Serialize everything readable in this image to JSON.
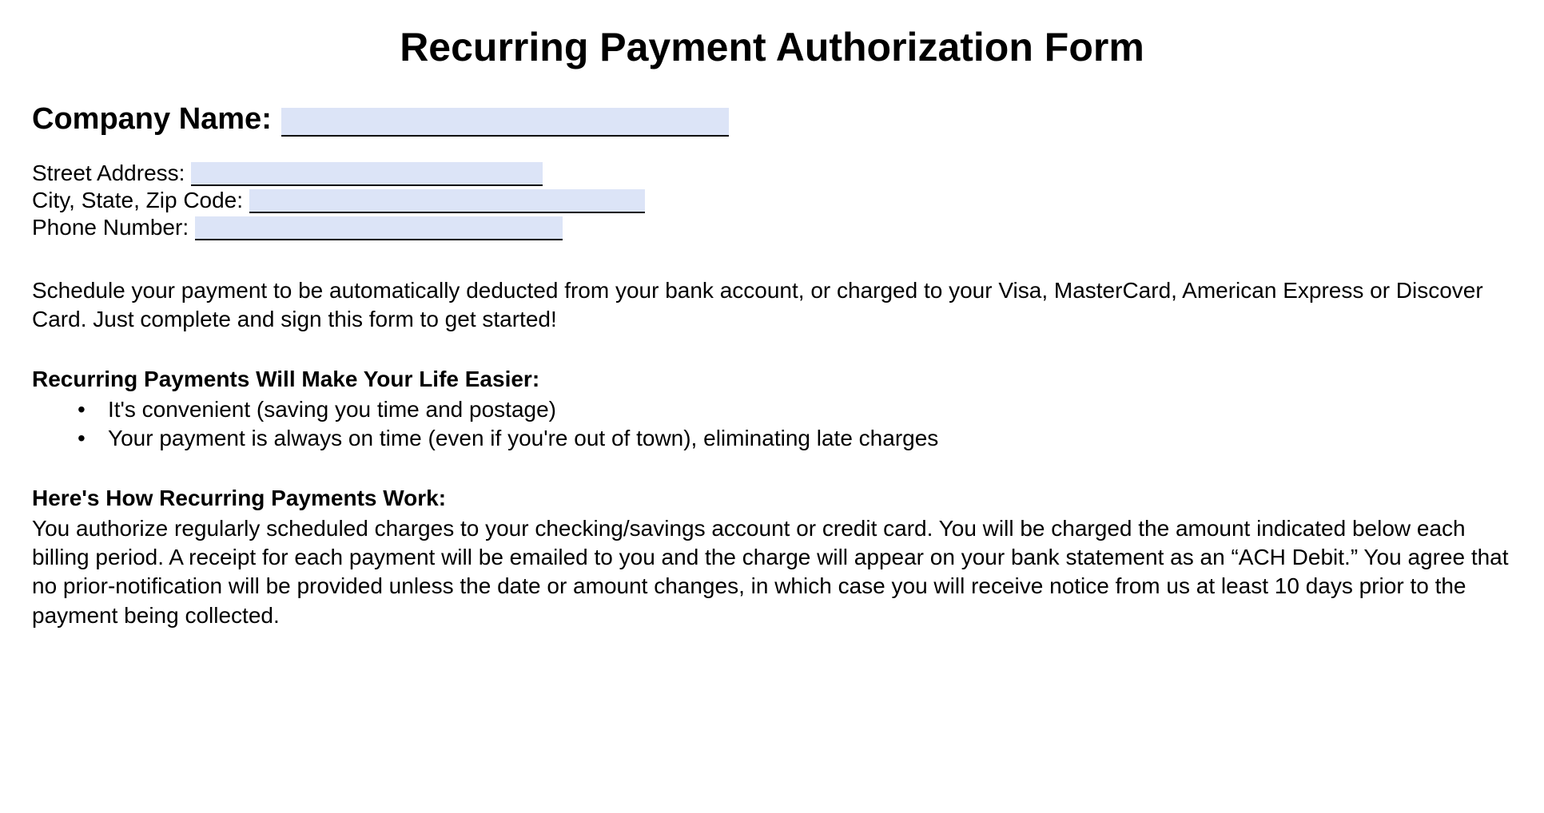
{
  "title": "Recurring Payment Authorization Form",
  "fields": {
    "company_label": "Company Name:",
    "street_label": "Street Address:",
    "city_label": "City, State, Zip Code:",
    "phone_label": "Phone Number:"
  },
  "intro": "Schedule your payment to be automatically deducted from your bank account, or charged to your Visa, MasterCard, American Express or Discover Card.  Just complete and sign this form to get started!",
  "benefits": {
    "heading": "Recurring Payments Will Make Your Life Easier:",
    "items": [
      "It's convenient (saving you time and postage)",
      "Your payment is always on time (even if you're out of town), eliminating late charges"
    ]
  },
  "how_it_works": {
    "heading": "Here's How Recurring Payments Work:",
    "text": "You authorize regularly scheduled charges to your checking/savings account or credit card.  You will be charged the amount indicated below each billing period.  A receipt for each payment will be emailed to you and the charge will appear on your bank statement as an “ACH Debit.”  You agree that no prior-notification will be provided unless the date or amount changes, in which case you will receive notice from us at least 10 days prior to the payment being collected."
  }
}
